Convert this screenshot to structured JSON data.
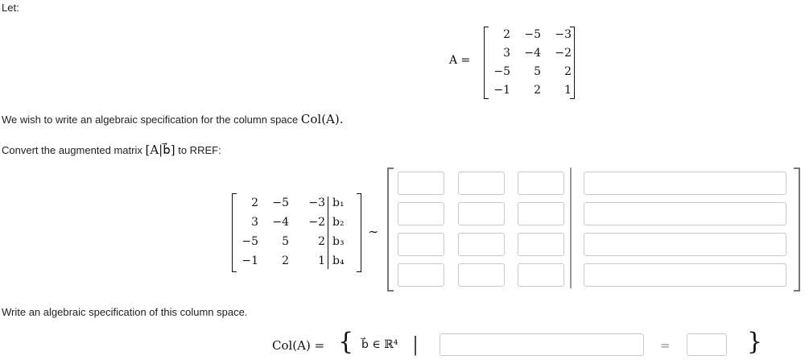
{
  "intro": "Let:",
  "matrix_A": {
    "label": "A =",
    "rows": [
      [
        "2",
        "−5",
        "−3"
      ],
      [
        "3",
        "−4",
        "−2"
      ],
      [
        "−5",
        "5",
        "2"
      ],
      [
        "−1",
        "2",
        "1"
      ]
    ]
  },
  "sentence1": {
    "text": "We wish to write an algebraic specification for the column space ",
    "math": "Col(A)."
  },
  "sentence2": {
    "text_before": "Convert the augmented matrix ",
    "math": "[A|b⃗]",
    "text_after": " to RREF:"
  },
  "augmented": {
    "rows": [
      [
        "2",
        "−5",
        "−3"
      ],
      [
        "3",
        "−4",
        "−2"
      ],
      [
        "−5",
        "5",
        "2"
      ],
      [
        "−1",
        "2",
        "1"
      ]
    ],
    "b_labels": [
      "b₁",
      "b₂",
      "b₃",
      "b₄"
    ]
  },
  "tilde": "∼",
  "rref_inputs": {
    "rows": [
      [
        "",
        "",
        "",
        ""
      ],
      [
        "",
        "",
        "",
        ""
      ],
      [
        "",
        "",
        "",
        ""
      ],
      [
        "",
        "",
        "",
        ""
      ]
    ]
  },
  "sentence3": "Write an algebraic specification of this column space.",
  "colspace": {
    "lhs": "Col(A) =",
    "open_brace": "{",
    "set_member": "b⃗ ∈ ℝ⁴",
    "bar": "|",
    "equals": "=",
    "close_brace": "}",
    "lhs_value": "",
    "rhs_value": ""
  }
}
